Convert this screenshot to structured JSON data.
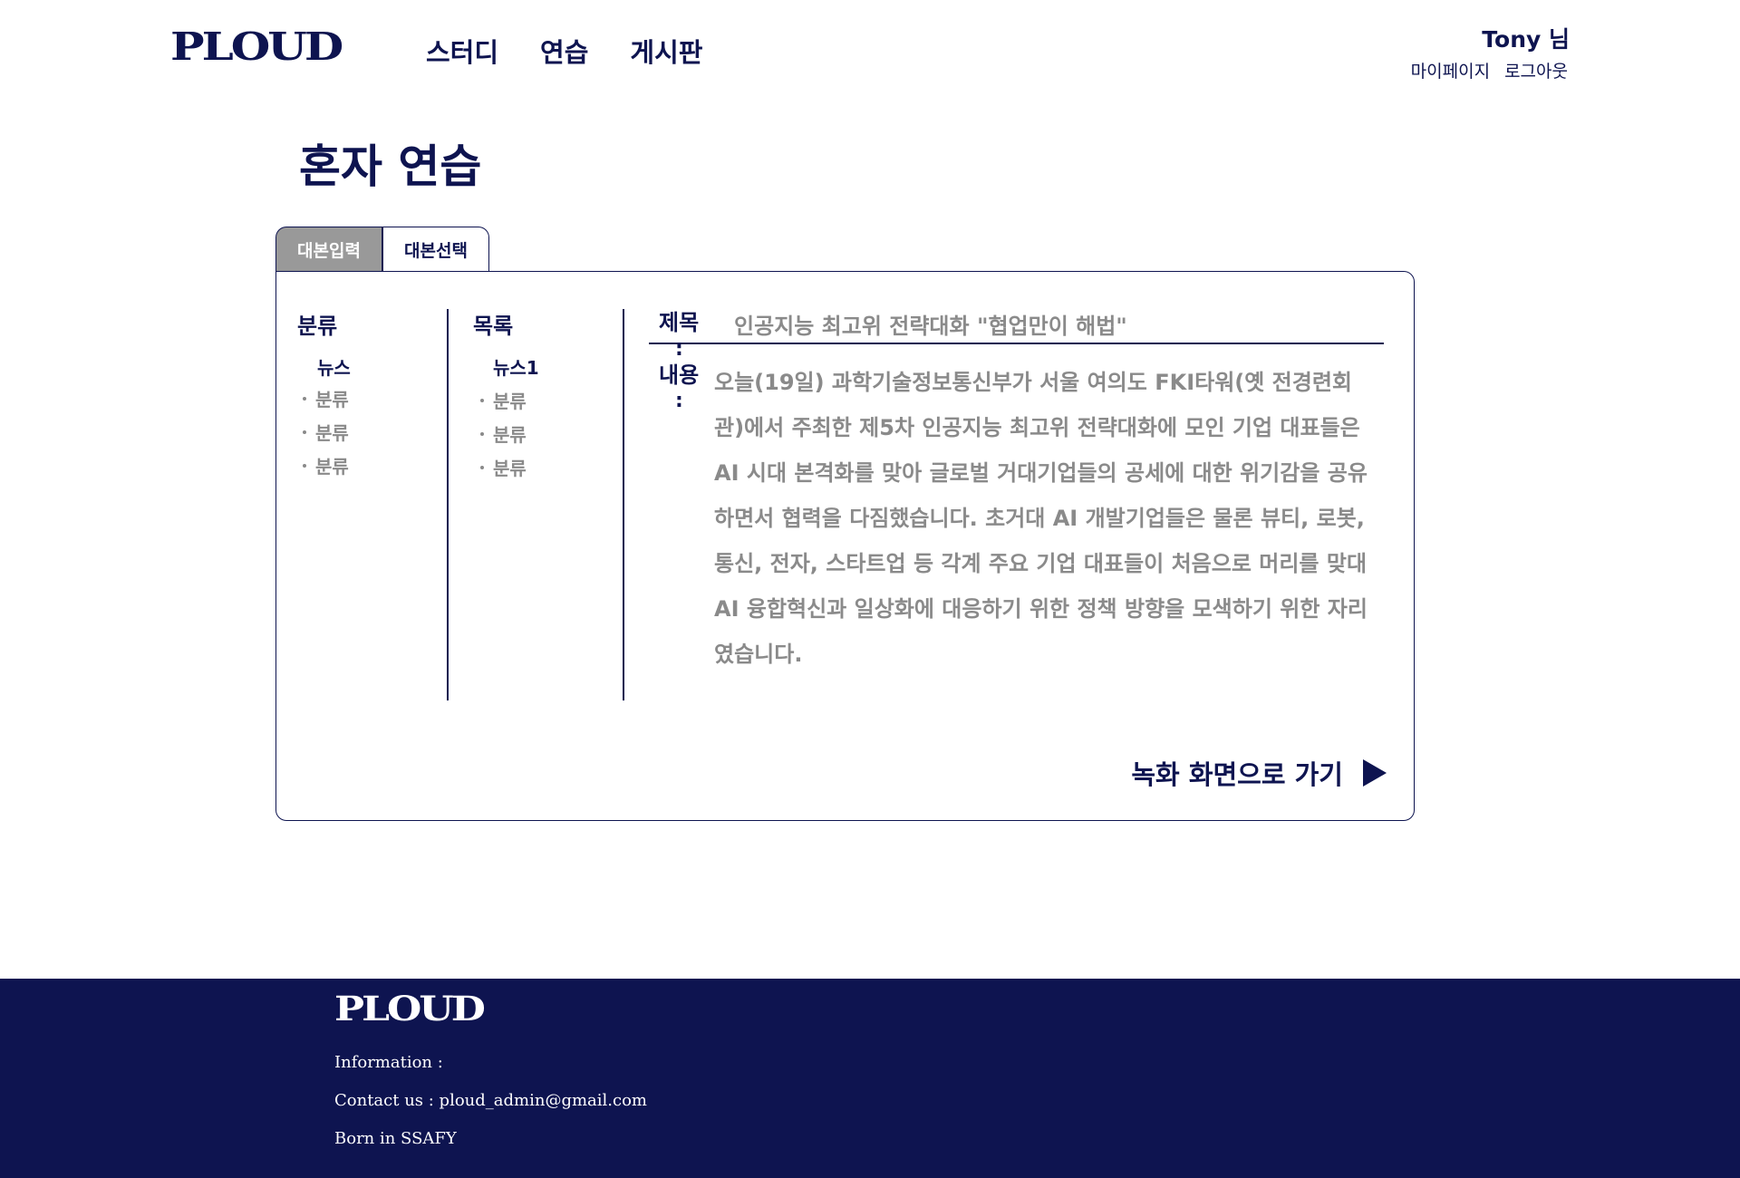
{
  "header": {
    "logo": "PLOUD",
    "nav": [
      "스터디",
      "연습",
      "게시판"
    ],
    "user_name": "Tony 님",
    "mypage": "마이페이지",
    "logout": "로그아웃"
  },
  "page": {
    "title": "혼자 연습"
  },
  "tabs": {
    "input": "대본입력",
    "select": "대본선택"
  },
  "category": {
    "heading": "분류",
    "active": "뉴스",
    "items": [
      "분류",
      "분류",
      "분류"
    ]
  },
  "list": {
    "heading": "목록",
    "active": "뉴스1",
    "items": [
      "분류",
      "분류",
      "분류"
    ]
  },
  "script": {
    "title_label": "제목",
    "title_value": "인공지능 최고위 전략대화 \"협업만이 해법\"",
    "content_label": "내용",
    "colon": ":",
    "content_value": "오늘(19일) 과학기술정보통신부가 서울 여의도 FKI타워(옛 전경련회관)에서 주최한 제5차 인공지능 최고위 전략대화에 모인 기업 대표들은 AI 시대 본격화를 맞아 글로벌 거대기업들의 공세에 대한 위기감을 공유하면서 협력을 다짐했습니다. 초거대 AI 개발기업들은 물론 뷰티, 로봇, 통신, 전자, 스타트업 등 각계 주요 기업 대표들이 처음으로 머리를 맞대 AI 융합혁신과 일상화에 대응하기 위한 정책 방향을 모색하기 위한 자리였습니다."
  },
  "action": {
    "go_record": "녹화 화면으로 가기",
    "icon": "play-icon"
  },
  "footer": {
    "logo": "PLOUD",
    "information": "Information :",
    "contact": "Contact us :  ploud_admin@gmail.com",
    "born": "Born in SSAFY"
  },
  "colors": {
    "navy": "#0e1450",
    "gray_text": "#8a8a8a",
    "tab_active_bg": "#999999"
  }
}
